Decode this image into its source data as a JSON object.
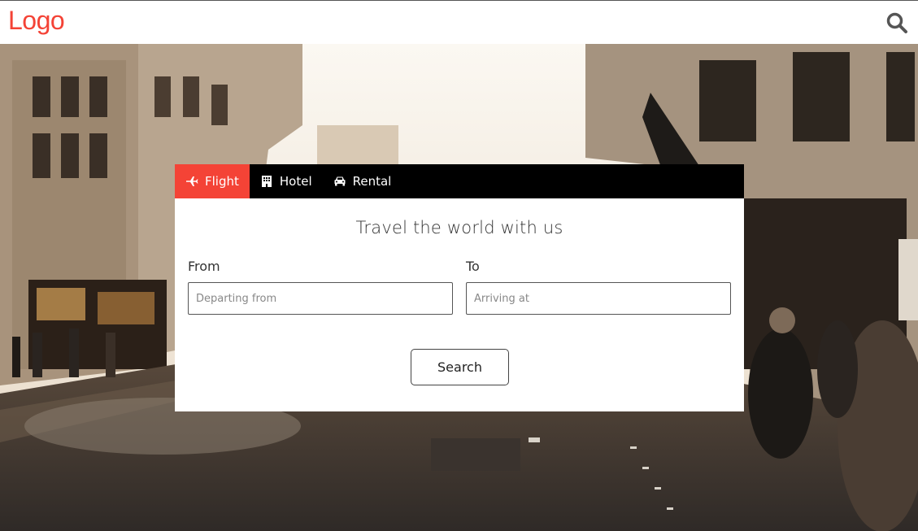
{
  "header": {
    "logo": "Logo",
    "search_icon": "search-icon",
    "logo_color": "#f44336"
  },
  "booking": {
    "tabs": [
      {
        "label": "Flight",
        "icon": "airplane-icon",
        "active": true
      },
      {
        "label": "Hotel",
        "icon": "building-icon",
        "active": false
      },
      {
        "label": "Rental",
        "icon": "car-icon",
        "active": false
      }
    ],
    "heading": "Travel the world with us",
    "from": {
      "label": "From",
      "placeholder": "Departing from",
      "value": ""
    },
    "to": {
      "label": "To",
      "placeholder": "Arriving at",
      "value": ""
    },
    "search_label": "Search",
    "accent_color": "#f44336"
  }
}
